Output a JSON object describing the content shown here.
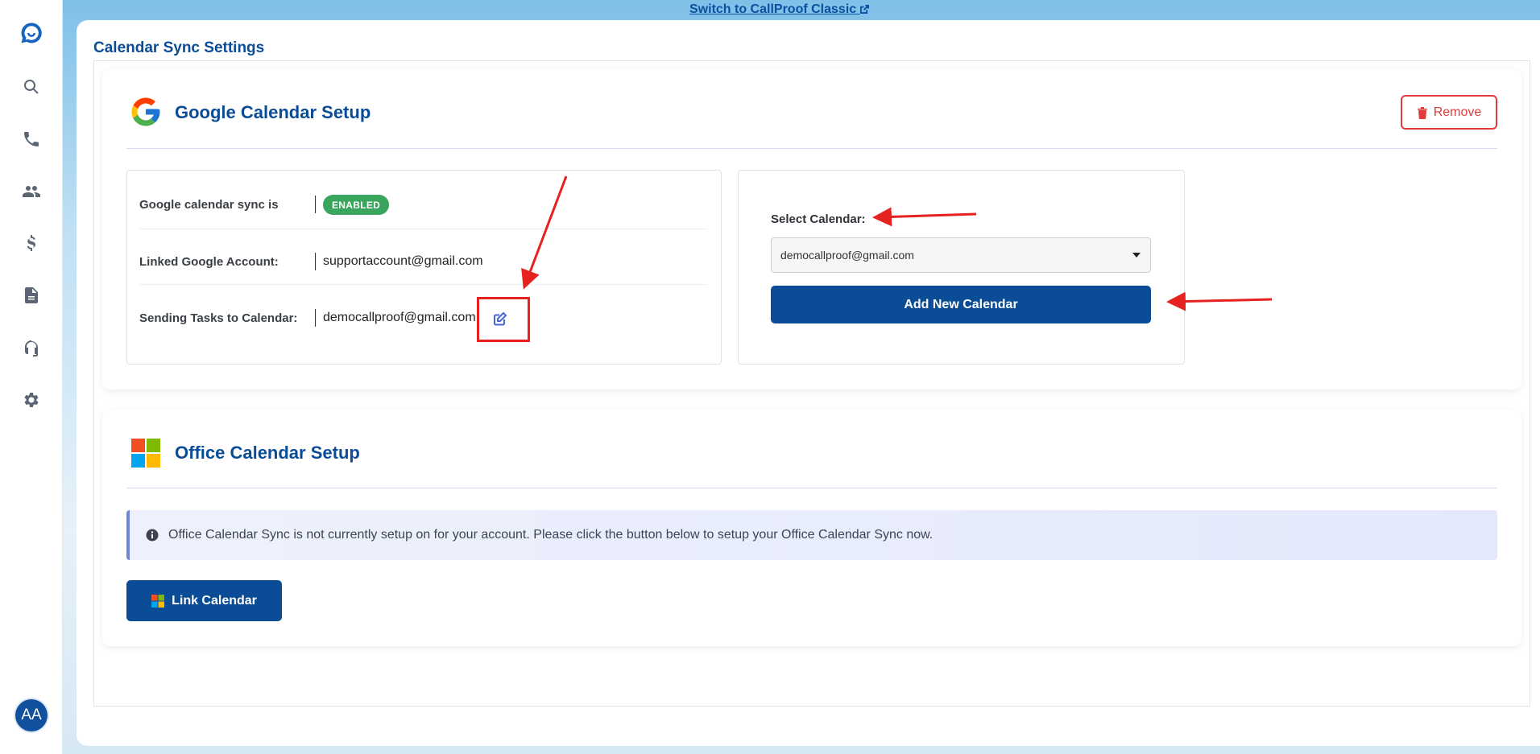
{
  "banner": {
    "switch_label": "Switch to CallProof Classic"
  },
  "sidebar": {
    "items": [
      {
        "icon": "search-icon"
      },
      {
        "icon": "phone-icon"
      },
      {
        "icon": "contacts-icon"
      },
      {
        "icon": "dollar-icon"
      },
      {
        "icon": "document-icon"
      },
      {
        "icon": "headset-icon"
      },
      {
        "icon": "gear-icon"
      }
    ],
    "avatar_initials": "AA"
  },
  "page": {
    "title": "Calendar Sync Settings"
  },
  "google": {
    "title": "Google Calendar Setup",
    "remove_label": "Remove",
    "rows": [
      {
        "label": "Google calendar sync is",
        "value": "ENABLED"
      },
      {
        "label": "Linked Google Account:",
        "value": "supportaccount@gmail.com"
      },
      {
        "label": "Sending Tasks to Calendar:",
        "value": "democallproof@gmail.com"
      }
    ],
    "select_label": "Select Calendar:",
    "selected_calendar": "democallproof@gmail.com",
    "add_label": "Add New Calendar"
  },
  "office": {
    "title": "Office Calendar Setup",
    "alert_text": "Office Calendar Sync is not currently setup on for your account. Please click the button below to setup your Office Calendar Sync now.",
    "link_label": "Link Calendar"
  },
  "colors": {
    "brand": "#0b4c97",
    "danger": "#e33a3a",
    "success": "#3aa55c",
    "annotation": "#e5221f"
  }
}
